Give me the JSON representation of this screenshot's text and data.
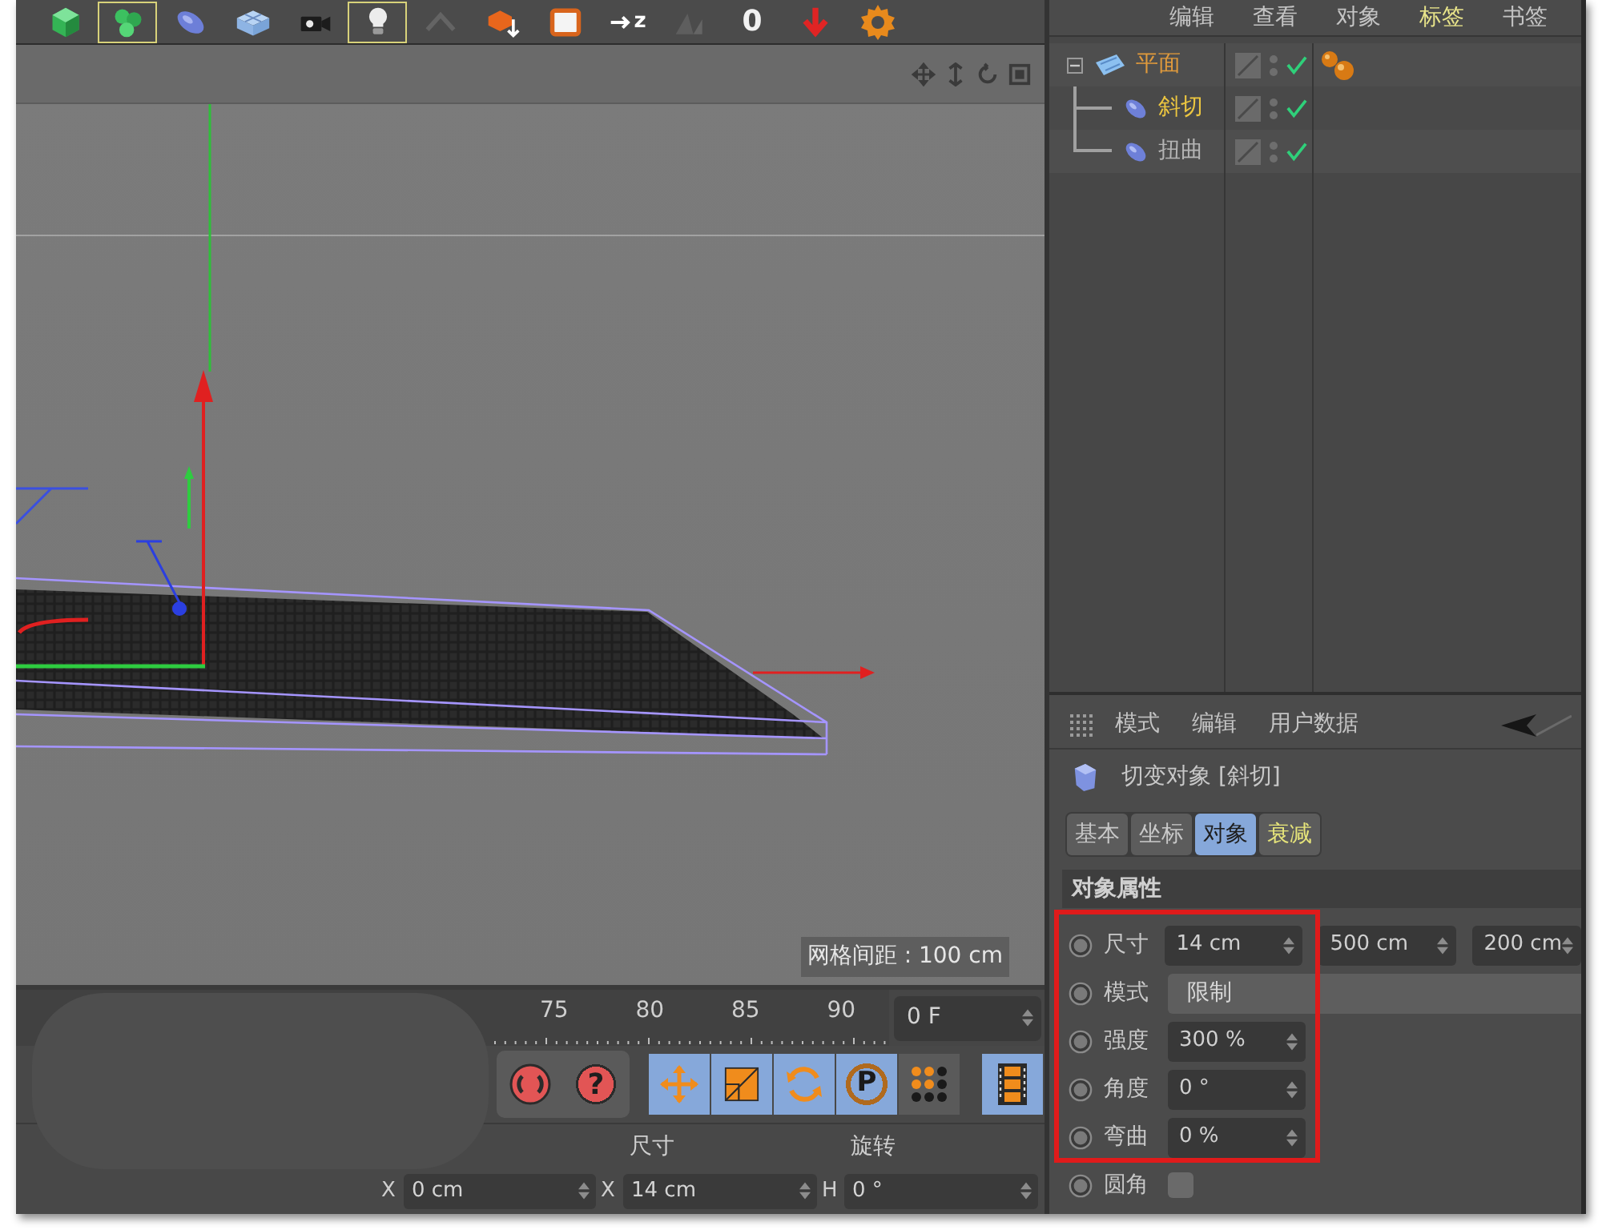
{
  "toolbar": {
    "tools": [
      {
        "kind": "cube",
        "selected": false,
        "disabled": false
      },
      {
        "kind": "generator",
        "selected": true,
        "disabled": false
      },
      {
        "kind": "deformer",
        "selected": false,
        "disabled": false
      },
      {
        "kind": "floor",
        "selected": false,
        "disabled": false
      },
      {
        "kind": "camera",
        "selected": false,
        "disabled": false
      },
      {
        "kind": "light",
        "selected": true,
        "disabled": false
      },
      {
        "kind": "peak",
        "selected": false,
        "disabled": true
      },
      {
        "kind": "render-object",
        "selected": false,
        "disabled": false
      },
      {
        "kind": "render-region",
        "selected": false,
        "disabled": false
      },
      {
        "kind": "axis",
        "label": "z",
        "selected": false,
        "disabled": false
      },
      {
        "kind": "snap",
        "selected": false,
        "disabled": true
      },
      {
        "kind": "counter",
        "label": "0"
      },
      {
        "kind": "arrow-down",
        "selected": false,
        "disabled": false
      },
      {
        "kind": "gear",
        "selected": false,
        "disabled": false
      }
    ]
  },
  "viewport": {
    "grid_spacing": "网格间距 : 100 cm"
  },
  "timeline": {
    "ticks": [
      "75",
      "80",
      "85",
      "90"
    ],
    "frame": "0 F"
  },
  "transport": {
    "buttons": [
      {
        "kind": "record",
        "selected": false
      },
      {
        "kind": "keyframe",
        "label": "?",
        "selected": false
      },
      {
        "kind": "position",
        "selected": true
      },
      {
        "kind": "scale",
        "selected": true
      },
      {
        "kind": "rotation",
        "selected": true
      },
      {
        "kind": "parameter",
        "label": "P",
        "selected": true
      },
      {
        "kind": "point-level",
        "selected": false
      },
      {
        "kind": "scheme",
        "selected": true
      }
    ]
  },
  "coordinates": {
    "headers": [
      "尺寸",
      "旋转"
    ],
    "fields": [
      {
        "axis": "X",
        "value": "0 cm"
      },
      {
        "axis": "X",
        "value": "14 cm"
      },
      {
        "axis": "H",
        "value": "0 °"
      }
    ]
  },
  "object_manager": {
    "menu": [
      {
        "label": "编辑",
        "selected": false
      },
      {
        "label": "查看",
        "selected": false
      },
      {
        "label": "对象",
        "selected": false
      },
      {
        "label": "标签",
        "selected": true
      },
      {
        "label": "书签",
        "selected": false
      }
    ],
    "objects": [
      {
        "name": "平面",
        "kind": "plane",
        "expanded": true,
        "selected": true,
        "active": false,
        "enabled": true,
        "tags": [
          {
            "kind": "phong"
          }
        ],
        "children": [
          {
            "name": "斜切",
            "kind": "deformer",
            "selected": true,
            "active": true,
            "enabled": true
          },
          {
            "name": "扭曲",
            "kind": "deformer",
            "selected": false,
            "active": false,
            "enabled": true
          }
        ]
      }
    ]
  },
  "attribute_manager": {
    "menu": [
      "模式",
      "编辑",
      "用户数据"
    ],
    "title": "切变对象 [斜切]",
    "tabs": [
      {
        "label": "基本",
        "selected": false,
        "highlighted": false
      },
      {
        "label": "坐标",
        "selected": false,
        "highlighted": false
      },
      {
        "label": "对象",
        "selected": true,
        "highlighted": false
      },
      {
        "label": "衰减",
        "selected": false,
        "highlighted": true
      }
    ],
    "section": "对象属性",
    "properties": [
      {
        "kind": "vector",
        "label": "尺寸",
        "values": [
          "14 cm",
          "500 cm",
          "200 cm"
        ]
      },
      {
        "kind": "dropdown",
        "label": "模式",
        "value": "限制"
      },
      {
        "kind": "number",
        "label": "强度",
        "value": "300 %"
      },
      {
        "kind": "number",
        "label": "角度",
        "value": "0 °"
      },
      {
        "kind": "number",
        "label": "弯曲",
        "value": "0 %"
      },
      {
        "kind": "checkbox",
        "label": "圆角",
        "checked": false
      }
    ]
  }
}
